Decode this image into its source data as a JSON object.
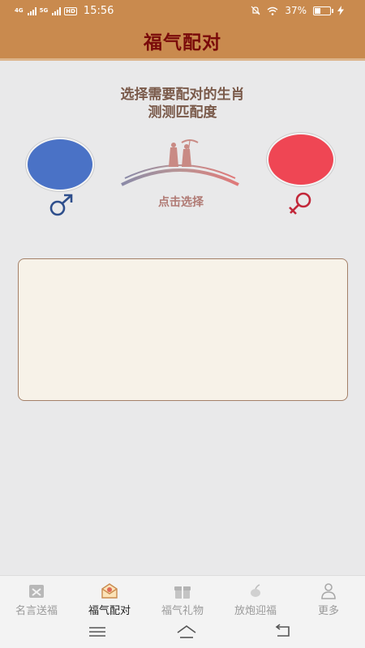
{
  "status_bar": {
    "network_1": "4G",
    "network_2": "5G",
    "hd": "HD",
    "time": "15:56",
    "battery_percent": "37%",
    "battery_level": 0.37
  },
  "header": {
    "title": "福气配对"
  },
  "main": {
    "prompt_line1": "选择需要配对的生肖",
    "prompt_line2": "测测匹配度",
    "select_label": "点击选择",
    "colors": {
      "male": "#4a72c6",
      "female": "#ef4654",
      "accent": "#c98a4e"
    }
  },
  "tabs": [
    {
      "label": "名言送福",
      "icon": "quote-card-icon",
      "active": false
    },
    {
      "label": "福气配对",
      "icon": "envelope-icon",
      "active": true
    },
    {
      "label": "福气礼物",
      "icon": "gift-icon",
      "active": false
    },
    {
      "label": "放炮迎福",
      "icon": "firecracker-icon",
      "active": false
    },
    {
      "label": "更多",
      "icon": "user-icon",
      "active": false
    }
  ],
  "nav": {
    "menu": "menu-icon",
    "home": "home-icon",
    "back": "back-icon"
  }
}
